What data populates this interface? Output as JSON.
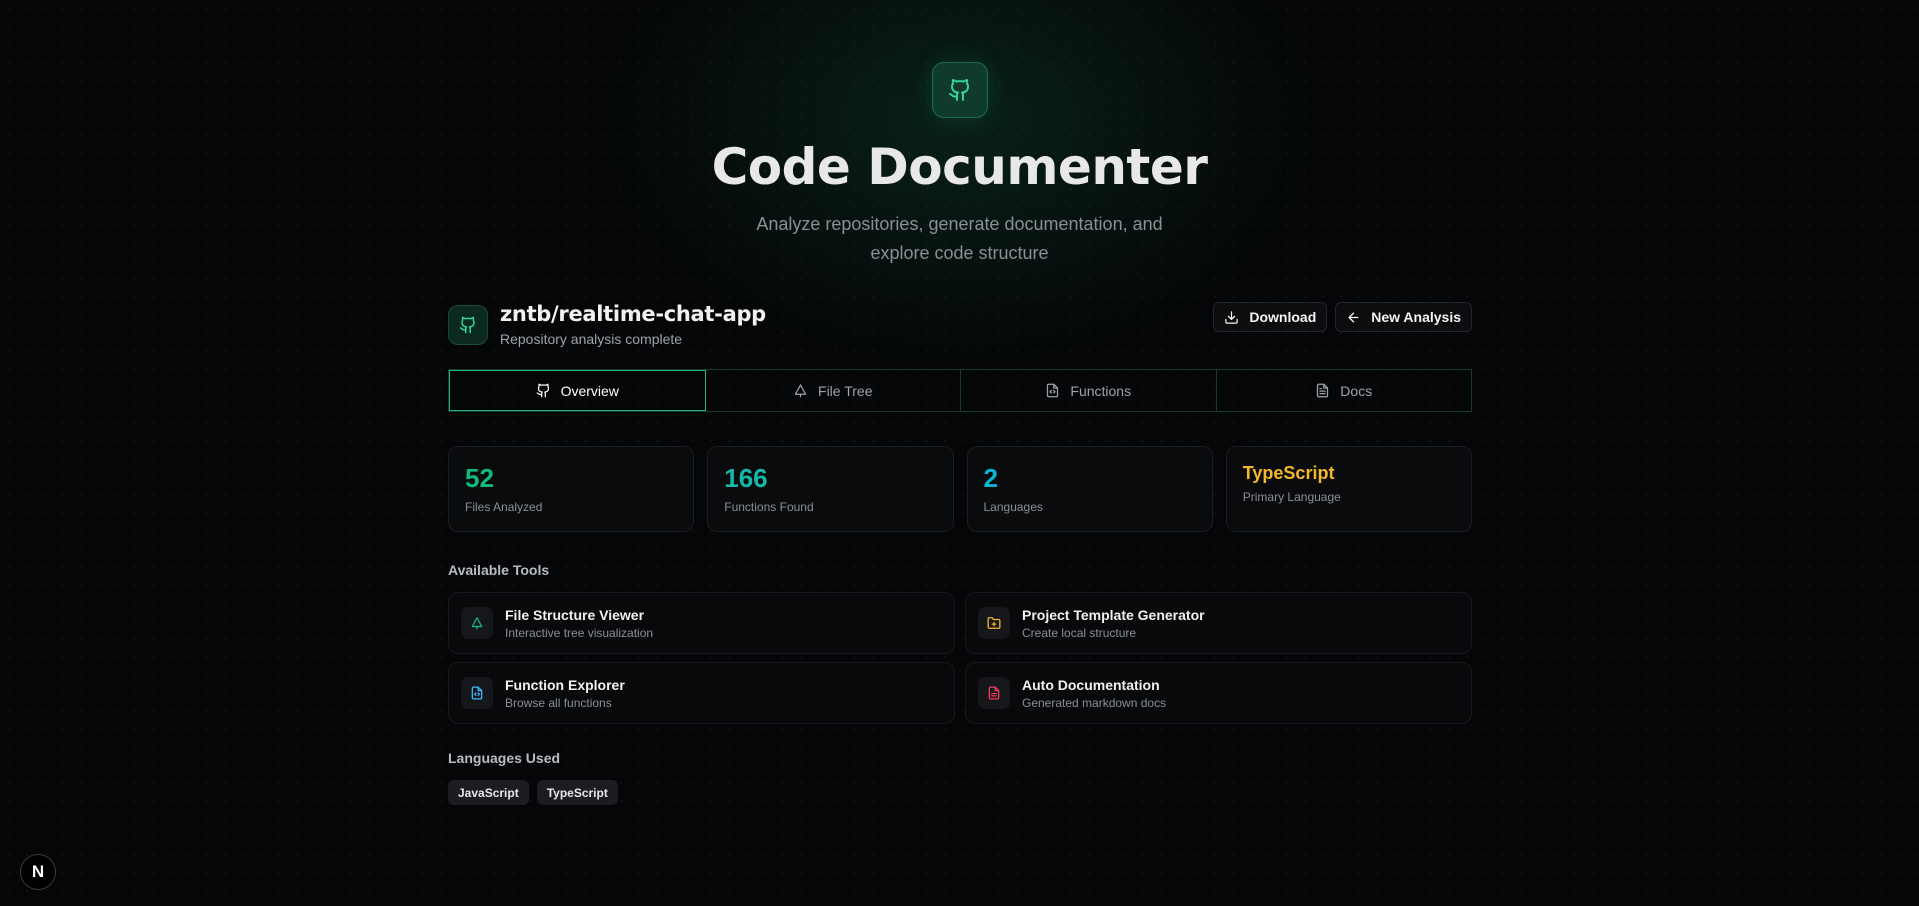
{
  "hero": {
    "title": "Code Documenter",
    "subtitle": "Analyze repositories, generate documentation, and explore code structure"
  },
  "repo": {
    "name": "zntb/realtime-chat-app",
    "status": "Repository analysis complete"
  },
  "actions": {
    "download": "Download",
    "new_analysis": "New Analysis"
  },
  "tabs": [
    {
      "label": "Overview",
      "icon": "github-icon"
    },
    {
      "label": "File Tree",
      "icon": "tree-icon"
    },
    {
      "label": "Functions",
      "icon": "file-code-icon"
    },
    {
      "label": "Docs",
      "icon": "file-text-icon"
    }
  ],
  "stats": [
    {
      "value": "52",
      "label": "Files Analyzed",
      "color": "#10b981"
    },
    {
      "value": "166",
      "label": "Functions Found",
      "color": "#14b8a6"
    },
    {
      "value": "2",
      "label": "Languages",
      "color": "#06b6d4"
    },
    {
      "value": "TypeScript",
      "label": "Primary Language",
      "color": "#f5b72a"
    }
  ],
  "tools_section": {
    "title": "Available Tools",
    "items": [
      {
        "name": "File Structure Viewer",
        "desc": "Interactive tree visualization",
        "icon": "tree-icon",
        "color": "#10b981"
      },
      {
        "name": "Project Template Generator",
        "desc": "Create local structure",
        "icon": "folder-plus-icon",
        "color": "#f5b72a"
      },
      {
        "name": "Function Explorer",
        "desc": "Browse all functions",
        "icon": "file-code-icon",
        "color": "#38bdf8"
      },
      {
        "name": "Auto Documentation",
        "desc": "Generated markdown docs",
        "icon": "file-text-icon",
        "color": "#f43f5e"
      }
    ]
  },
  "languages_section": {
    "title": "Languages Used",
    "items": [
      "JavaScript",
      "TypeScript"
    ]
  },
  "badge": {
    "letter": "N"
  }
}
